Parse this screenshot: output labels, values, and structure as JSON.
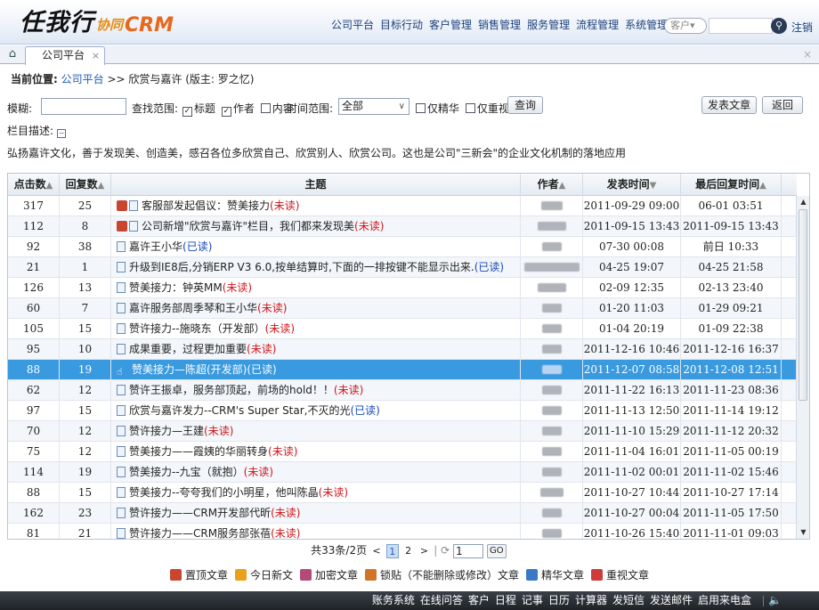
{
  "header": {
    "logo_main": "任我行",
    "logo_sub": "协同",
    "logo_crm": "CRM",
    "nav": [
      "公司平台",
      "目标行动",
      "客户管理",
      "销售管理",
      "服务管理",
      "流程管理",
      "系统管理"
    ],
    "search_scope": "客户▾",
    "logout": "注销"
  },
  "tabs": {
    "home_icon": "home-icon",
    "active_tab": "公司平台",
    "tab_close": "×",
    "panel_close": "×"
  },
  "breadcrumb": {
    "label": "当前位置:",
    "link": "公司平台",
    "rest": ">> 欣赏与嘉许 (版主: 罗之忆)"
  },
  "filter": {
    "fuzzy_label": "模糊:",
    "fuzzy_value": "",
    "scope_label": "查找范围:",
    "scope_title": "标题",
    "scope_author": "作者",
    "scope_content": "内容",
    "time_label": "时间范围:",
    "time_value": "全部",
    "only_featured": "仅精华",
    "only_important": "仅重视",
    "query_button": "查询",
    "post_button": "发表文章",
    "back_button": "返回"
  },
  "column_desc": {
    "label": "栏目描述:",
    "text": "弘扬嘉许文化，善于发现美、创造美，感召各位多欣赏自己、欣赏别人、欣赏公司。这也是公司\"三新会\"的企业文化机制的落地应用"
  },
  "table": {
    "columns": [
      "点击数",
      "回复数",
      "主题",
      "作者",
      "发表时间",
      "最后回复时间"
    ],
    "sort_marks": [
      "▲",
      "▲",
      "",
      "▲",
      "▼",
      "▲"
    ],
    "rows": [
      {
        "clicks": "317",
        "replies": "25",
        "pinned": true,
        "title": "客服部发起倡议：赞美接力",
        "status": "(未读)",
        "read": false,
        "author_w": 24,
        "posted": "2011-09-29 09:00",
        "last": "06-01 03:51"
      },
      {
        "clicks": "112",
        "replies": "8",
        "pinned": true,
        "title": "公司新增\"欣赏与嘉许\"栏目，我们都来发现美",
        "status": "(未读)",
        "read": false,
        "author_w": 32,
        "posted": "2011-09-15 13:43",
        "last": "2011-09-15 13:43"
      },
      {
        "clicks": "92",
        "replies": "38",
        "pinned": false,
        "title": "嘉许王小华",
        "status": "(已读)",
        "read": true,
        "author_w": 22,
        "posted": "07-30 00:08",
        "last": "前日 10:33"
      },
      {
        "clicks": "21",
        "replies": "1",
        "pinned": false,
        "title": "升级到IE8后,分销ERP V3 6.0,按单结算时,下面的一排按键不能显示出来.",
        "status": "(已读)",
        "read": true,
        "author_w": 62,
        "posted": "04-25 19:07",
        "last": "04-25 21:58"
      },
      {
        "clicks": "126",
        "replies": "13",
        "pinned": false,
        "title": "赞美接力：钟英MM",
        "status": "(未读)",
        "read": false,
        "author_w": 32,
        "posted": "02-09 12:35",
        "last": "02-13 23:40"
      },
      {
        "clicks": "60",
        "replies": "7",
        "pinned": false,
        "title": "嘉许服务部周季琴和王小华",
        "status": "(未读)",
        "read": false,
        "author_w": 22,
        "posted": "01-20 11:03",
        "last": "01-29 09:21"
      },
      {
        "clicks": "105",
        "replies": "15",
        "pinned": false,
        "title": "赞许接力--施晓东（开发部）",
        "status": "(未读)",
        "read": false,
        "author_w": 22,
        "posted": "01-04 20:19",
        "last": "01-09 22:38"
      },
      {
        "clicks": "95",
        "replies": "10",
        "pinned": false,
        "title": "成果重要，过程更加重要",
        "status": "(未读)",
        "read": false,
        "author_w": 22,
        "posted": "2011-12-16 10:46",
        "last": "2011-12-16 16:37"
      },
      {
        "clicks": "88",
        "replies": "19",
        "pinned": false,
        "selected": true,
        "title": "赞美接力—陈超(开发部)",
        "status": "(已读)",
        "read": true,
        "author_w": 22,
        "posted": "2011-12-07 08:58",
        "last": "2011-12-08 12:51"
      },
      {
        "clicks": "62",
        "replies": "12",
        "pinned": false,
        "title": "赞许王振卓，服务部顶起，前场的hold！！",
        "status": "(未读)",
        "read": false,
        "author_w": 22,
        "posted": "2011-11-22 16:13",
        "last": "2011-11-23 08:36"
      },
      {
        "clicks": "97",
        "replies": "15",
        "pinned": false,
        "title": "欣赏与嘉许发力--CRM's Super Star,不灭的光",
        "status": "(已读)",
        "read": true,
        "author_w": 22,
        "posted": "2011-11-13 12:50",
        "last": "2011-11-14 19:12"
      },
      {
        "clicks": "70",
        "replies": "12",
        "pinned": false,
        "title": "赞许接力—王建",
        "status": "(未读)",
        "read": false,
        "author_w": 22,
        "posted": "2011-11-10 15:29",
        "last": "2011-11-12 20:32"
      },
      {
        "clicks": "75",
        "replies": "12",
        "pinned": false,
        "title": "赞美接力——霞姨的华丽转身",
        "status": "(未读)",
        "read": false,
        "author_w": 22,
        "posted": "2011-11-04 16:01",
        "last": "2011-11-05 00:19"
      },
      {
        "clicks": "114",
        "replies": "19",
        "pinned": false,
        "title": "赞美接力--九宝（就抱）",
        "status": "(未读)",
        "read": false,
        "author_w": 22,
        "posted": "2011-11-02 00:01",
        "last": "2011-11-02 15:46"
      },
      {
        "clicks": "88",
        "replies": "15",
        "pinned": false,
        "title": "赞美接力--夸夸我们的小明星，他叫陈晶",
        "status": "(未读)",
        "read": false,
        "author_w": 26,
        "posted": "2011-10-27 10:44",
        "last": "2011-10-27 17:14"
      },
      {
        "clicks": "162",
        "replies": "23",
        "pinned": false,
        "title": "赞许接力——CRM开发部代昕",
        "status": "(未读)",
        "read": false,
        "author_w": 22,
        "posted": "2011-10-27 00:04",
        "last": "2011-11-05 17:50"
      },
      {
        "clicks": "81",
        "replies": "21",
        "pinned": false,
        "title": "赞许接力——CRM服务部张蓓",
        "status": "(未读)",
        "read": false,
        "author_w": 22,
        "posted": "2011-10-26 15:40",
        "last": "2011-11-01 09:03"
      }
    ]
  },
  "pager": {
    "summary": "共33条/2页",
    "prev": "<",
    "pages": [
      "1",
      "2"
    ],
    "next": ">",
    "input_value": "1",
    "go": "GO"
  },
  "legend": [
    {
      "icon": "pin-icon",
      "color": "#c8462f",
      "label": "置顶文章"
    },
    {
      "icon": "new-icon",
      "color": "#e8a11a",
      "label": "今日新文"
    },
    {
      "icon": "lock-icon",
      "color": "#b34a7a",
      "label": "加密文章"
    },
    {
      "icon": "locked-post-icon",
      "color": "#d0742a",
      "label": "锁贴（不能删除或修改）文章"
    },
    {
      "icon": "featured-icon",
      "color": "#3a78c8",
      "label": "精华文章"
    },
    {
      "icon": "important-icon",
      "color": "#cf3b3b",
      "label": "重视文章"
    }
  ],
  "statusbar": {
    "items": [
      "账务系统",
      "在线问答",
      "客户",
      "日程",
      "记事",
      "日历",
      "计算器",
      "发短信",
      "发送邮件",
      "启用来电盒"
    ]
  }
}
